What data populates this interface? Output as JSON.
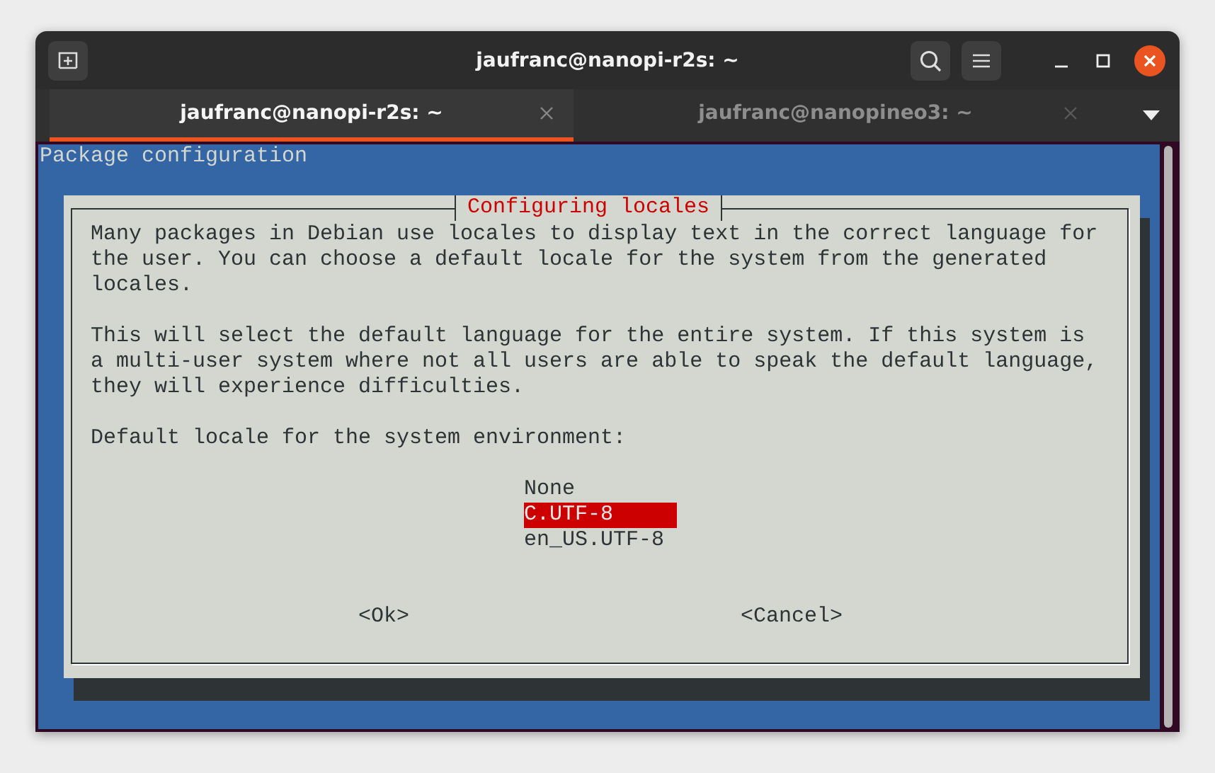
{
  "window": {
    "title": "jaufranc@nanopi-r2s: ~"
  },
  "tabs": [
    {
      "label": "jaufranc@nanopi-r2s: ~",
      "selected": true
    },
    {
      "label": "jaufranc@nanopineo3: ~",
      "selected": false
    }
  ],
  "terminal": {
    "header": "Package configuration"
  },
  "dialog": {
    "title": "Configuring locales",
    "paragraphs": [
      "Many packages in Debian use locales to display text in the correct language for the user. You can choose a default locale for the system from the generated locales.",
      "This will select the default language for the entire system. If this system is a multi-user system where not all users are able to speak the default language, they will experience difficulties."
    ],
    "prompt": "Default locale for the system environment:",
    "options": [
      {
        "label": "None",
        "selected": false
      },
      {
        "label": "C.UTF-8",
        "selected": true
      },
      {
        "label": "en_US.UTF-8",
        "selected": false
      }
    ],
    "buttons": [
      "<Ok>",
      "<Cancel>"
    ]
  }
}
